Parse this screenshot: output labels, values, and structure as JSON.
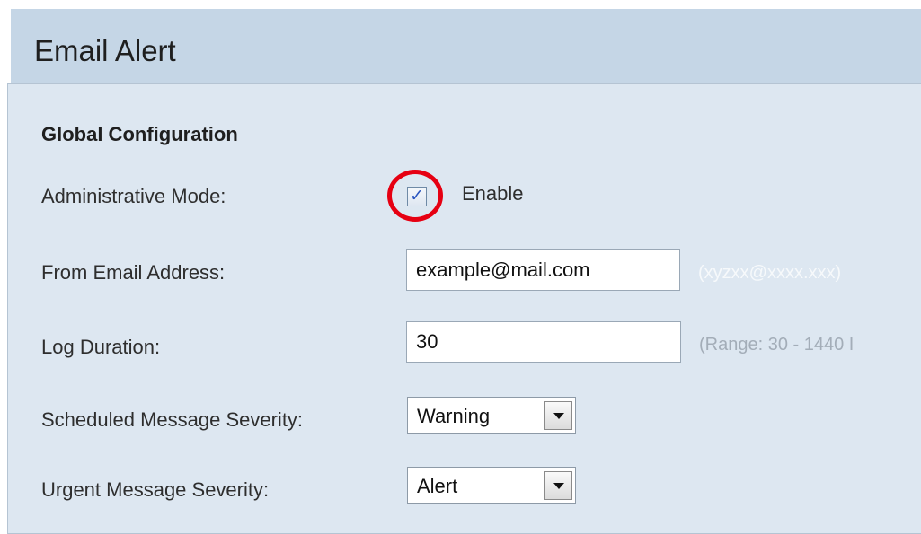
{
  "page": {
    "title": "Email Alert"
  },
  "global_config": {
    "heading": "Global Configuration",
    "admin_mode": {
      "label": "Administrative Mode:",
      "checked": true,
      "checkbox_glyph": "✓",
      "option_label": "Enable"
    },
    "from_email": {
      "label": "From Email Address:",
      "value": "example@mail.com",
      "hint": "(xyzxx@xxxx.xxx)"
    },
    "log_duration": {
      "label": "Log Duration:",
      "value": "30",
      "hint": "(Range: 30 - 1440 I"
    },
    "scheduled_severity": {
      "label": "Scheduled Message Severity:",
      "selected": "Warning"
    },
    "urgent_severity": {
      "label": "Urgent Message Severity:",
      "selected": "Alert"
    }
  },
  "colors": {
    "header_bg": "#c5d6e6",
    "panel_bg": "#dde7f1",
    "highlight_ring": "#e60012",
    "checkmark": "#2a55c0"
  },
  "icons": {
    "checkbox_check": "checkmark-icon",
    "dropdown_arrow": "chevron-down-icon",
    "annotation": "highlight-circle-icon"
  }
}
